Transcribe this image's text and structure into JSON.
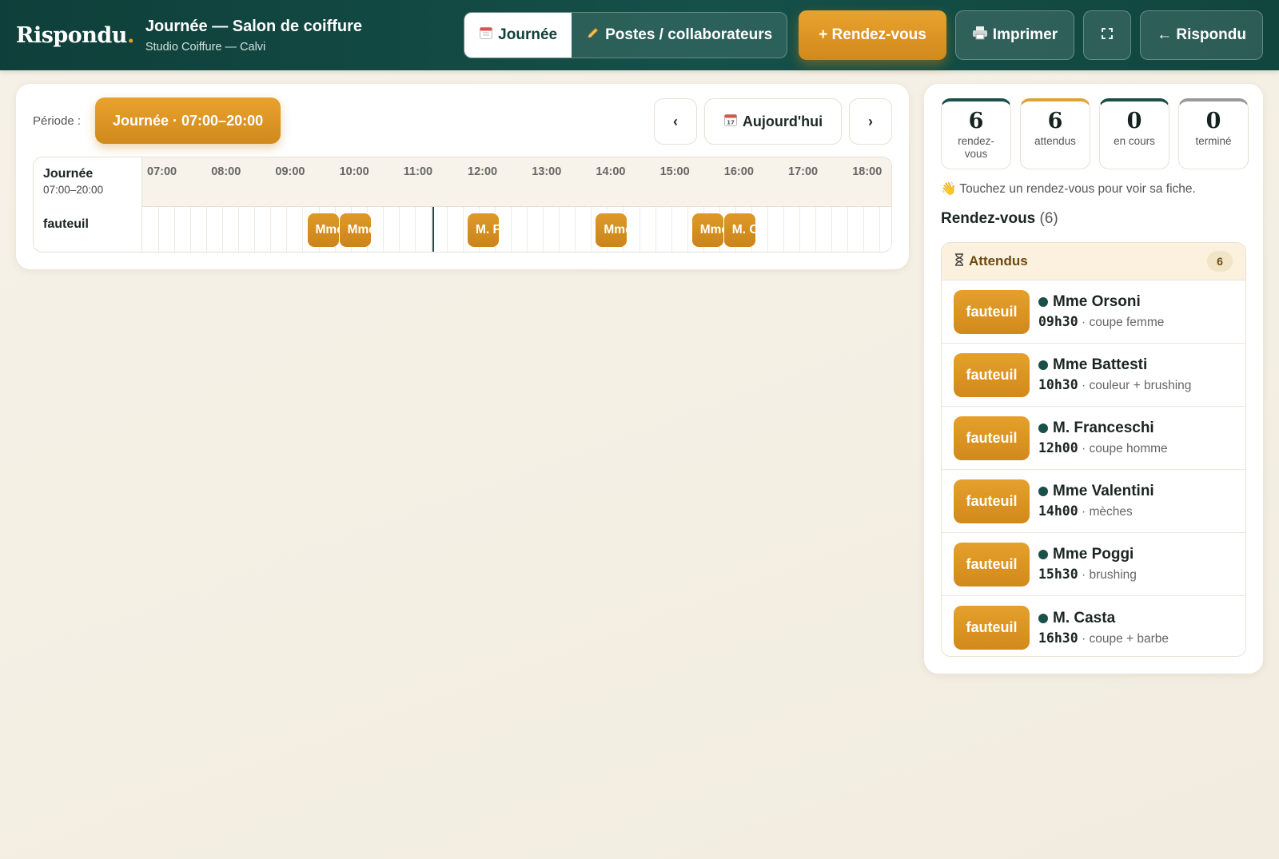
{
  "header": {
    "brand": "Rispondu",
    "brand_dot": ".",
    "title": "Journée — Salon de coiffure",
    "subtitle": "Studio Coiffure — Calvi",
    "tabs": [
      {
        "label": "Journée",
        "icon": "calendar-icon",
        "active": true
      },
      {
        "label": "Postes / collaborateurs",
        "icon": "pencil-icon",
        "active": false
      }
    ],
    "new_appt": "+ Rendez-vous",
    "print": "Imprimer",
    "fullscreen_icon": "fullscreen-icon",
    "back": "← Rispondu"
  },
  "planner": {
    "periode_label": "Période :",
    "periode_value": "Journée · 07:00–20:00",
    "prev": "‹",
    "today": "Aujourd'hui",
    "next": "›",
    "grid": {
      "corner_title": "Journée",
      "corner_sub": "07:00–20:00",
      "hours": [
        "07:00",
        "08:00",
        "09:00",
        "10:00",
        "11:00",
        "12:00",
        "13:00",
        "14:00",
        "15:00",
        "16:00",
        "17:00",
        "18:00"
      ],
      "row_label": "fauteuil",
      "appointments": [
        {
          "label": "Mme Orsoni",
          "start": "09:30",
          "duration_min": 30
        },
        {
          "label": "Mme Battesti",
          "start": "10:00",
          "duration_min": 30
        },
        {
          "label": "M. Franceschi",
          "start": "12:00",
          "duration_min": 30
        },
        {
          "label": "Mme Valentini",
          "start": "14:00",
          "duration_min": 30
        },
        {
          "label": "Mme Poggi",
          "start": "15:30",
          "duration_min": 30
        },
        {
          "label": "M. Casta",
          "start": "16:00",
          "duration_min": 30
        }
      ]
    }
  },
  "sidebar": {
    "stats": [
      {
        "value": "6",
        "label": "rendez-vous",
        "kind": "total"
      },
      {
        "value": "6",
        "label": "attendus",
        "kind": "wait"
      },
      {
        "value": "0",
        "label": "en cours",
        "kind": "run"
      },
      {
        "value": "0",
        "label": "terminé",
        "kind": "done"
      }
    ],
    "hint": "👋 Touchez un rendez-vous pour voir sa fiche.",
    "list_title": "Rendez-vous",
    "list_count": "(6)",
    "group": {
      "title": "Attendus",
      "icon": "hourglass-icon",
      "count": "6",
      "items": [
        {
          "chip": "fauteuil",
          "name": "Mme Orsoni",
          "time": "09h30",
          "service": "coupe femme"
        },
        {
          "chip": "fauteuil",
          "name": "Mme Battesti",
          "time": "10h30",
          "service": "couleur + brushing"
        },
        {
          "chip": "fauteuil",
          "name": "M. Franceschi",
          "time": "12h00",
          "service": "coupe homme"
        },
        {
          "chip": "fauteuil",
          "name": "Mme Valentini",
          "time": "14h00",
          "service": "mèches"
        },
        {
          "chip": "fauteuil",
          "name": "Mme Poggi",
          "time": "15h30",
          "service": "brushing"
        },
        {
          "chip": "fauteuil",
          "name": "M. Casta",
          "time": "16h30",
          "service": "coupe + barbe"
        }
      ]
    }
  },
  "colors": {
    "header_bg": "#0f3f3a",
    "accent": "#e29a26",
    "status_green": "#1a5049"
  }
}
